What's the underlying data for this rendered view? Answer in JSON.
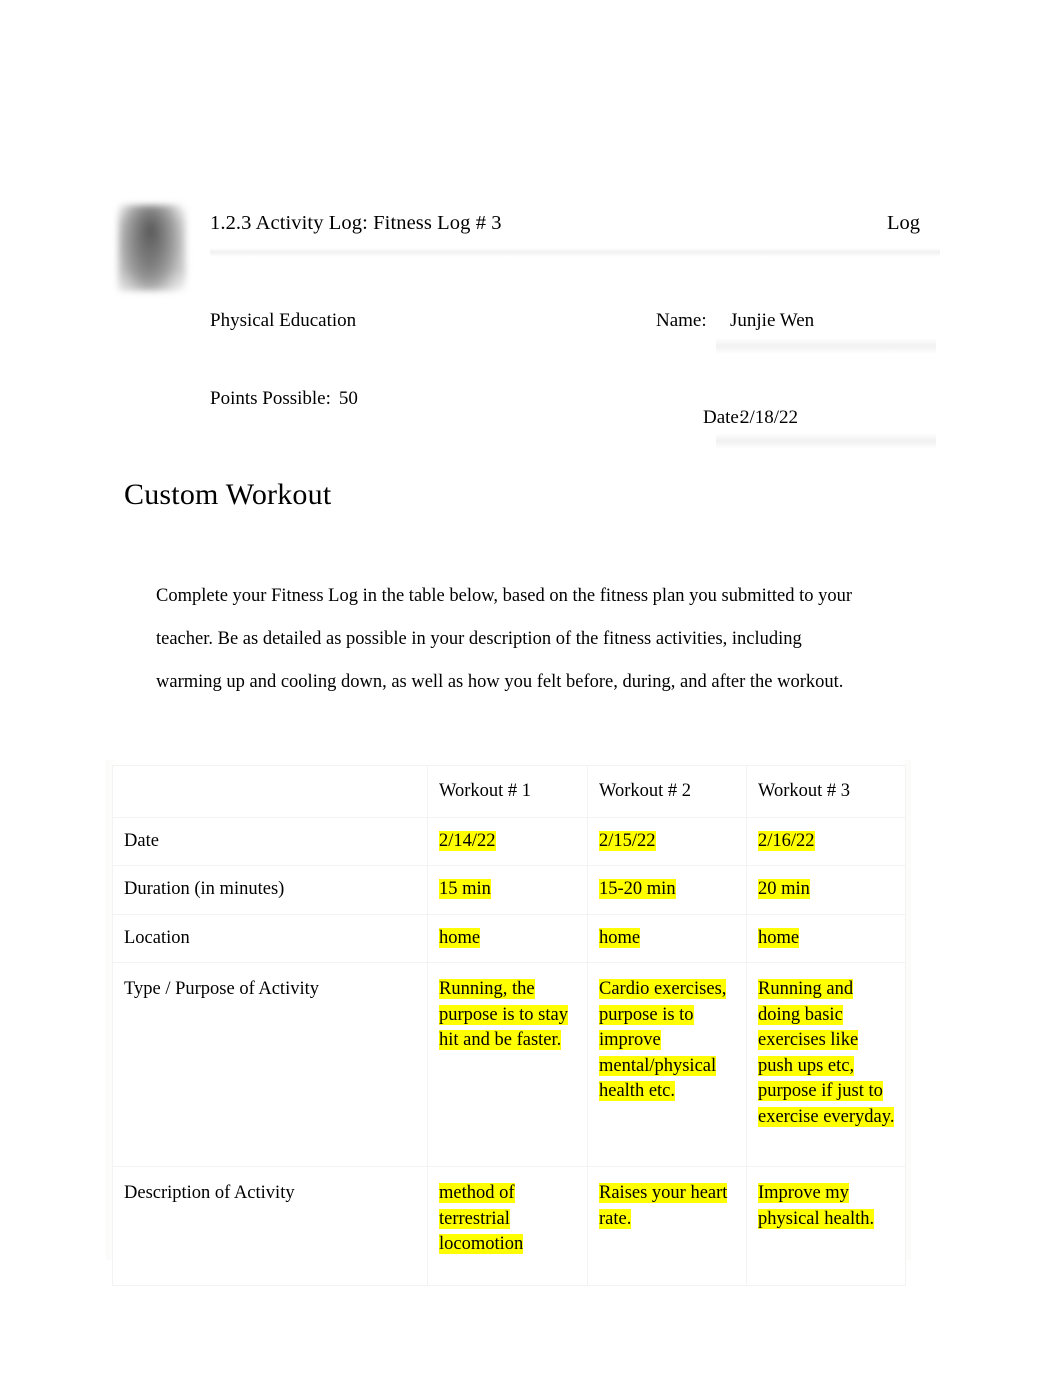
{
  "header": {
    "logo_alt": "school-logo",
    "title": "1.2.3 Activity Log: Fitness Log # 3",
    "right_label": "Log"
  },
  "meta": {
    "subject": "Physical Education",
    "points_label": "Points Possible:",
    "points_value": "50",
    "name_label": "Name:",
    "name_value": "Junjie Wen",
    "date_label": "Date:",
    "date_value": "2/18/22"
  },
  "section": {
    "heading": "Custom Workout",
    "instructions": "Complete your Fitness Log in the table below, based on the fitness plan you submitted to your teacher. Be as detailed as possible in your description of the fitness activities, including warming up and cooling down, as well as how you felt before, during, and after the workout."
  },
  "table": {
    "corner_label": "",
    "columns": [
      "Workout # 1",
      "Workout # 2",
      "Workout # 3"
    ],
    "rows": [
      {
        "label": "Date",
        "cells": [
          "2/14/22",
          "2/15/22",
          "2/16/22"
        ]
      },
      {
        "label": "Duration (in minutes)",
        "cells": [
          "15 min",
          "15-20 min",
          "20 min"
        ]
      },
      {
        "label": "Location",
        "cells": [
          "home",
          "home",
          "home"
        ]
      },
      {
        "label": "Type / Purpose of Activity",
        "cells": [
          "Running, the purpose is to stay hit and be faster.",
          "Cardio exercises, purpose is to improve mental/physical health etc.",
          "Running and doing basic exercises like push ups etc, purpose if just to exercise everyday."
        ]
      },
      {
        "label": "Description of Activity",
        "cells": [
          "method of terrestrial locomotion",
          "Raises your heart rate.",
          "Improve my physical health."
        ]
      }
    ]
  },
  "colors": {
    "highlight": "#ffff00",
    "text": "#000000",
    "border": "#f3f3f2",
    "page_background": "#ffffff"
  }
}
